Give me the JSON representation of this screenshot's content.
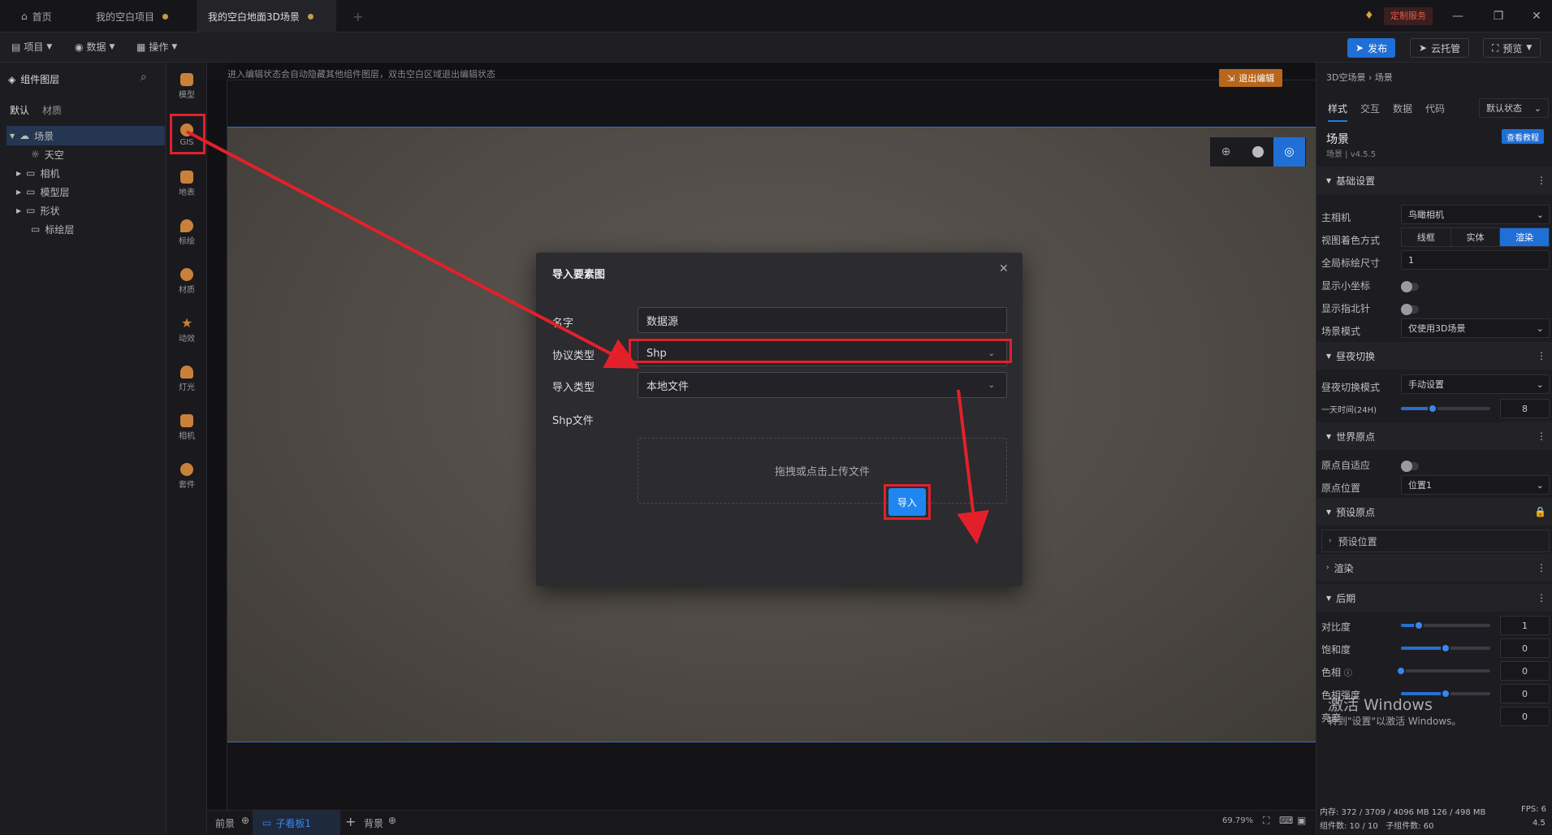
{
  "titlebar": {
    "tabs": [
      {
        "label": "首页"
      },
      {
        "label": "我的空白项目"
      },
      {
        "label": "我的空白地面3D场景"
      }
    ],
    "add_tab": "+",
    "custom_service": "定制服务"
  },
  "toolbar": {
    "menus": [
      "项目",
      "数据",
      "操作"
    ],
    "publish": "发布",
    "cloud_host": "云托管",
    "preview": "预览"
  },
  "layers": {
    "title": "组件图层",
    "tabs": [
      "默认",
      "材质"
    ],
    "items": [
      {
        "label": "场景"
      },
      {
        "label": "天空"
      },
      {
        "label": "相机"
      },
      {
        "label": "模型层"
      },
      {
        "label": "形状"
      },
      {
        "label": "标绘层"
      }
    ]
  },
  "strip": {
    "items": [
      "模型",
      "GIS",
      "地表",
      "标绘",
      "材质",
      "动效",
      "灯光",
      "相机",
      "套件"
    ]
  },
  "canvas": {
    "hint": "进入编辑状态会自动隐藏其他组件图层，双击空白区域退出编辑状态",
    "exit_edit": "退出编辑"
  },
  "modal": {
    "title": "导入要素图",
    "name_label": "名字",
    "name_value": "数据源",
    "protocol_label": "协议类型",
    "protocol_value": "Shp",
    "import_type_label": "导入类型",
    "import_type_value": "本地文件",
    "shp_label": "Shp文件",
    "upload_hint": "拖拽或点击上传文件",
    "import_button": "导入"
  },
  "props": {
    "breadcrumb": "3D空场景 › 场景",
    "tabs": [
      "样式",
      "交互",
      "数据",
      "代码"
    ],
    "state_select": "默认状态",
    "component_name": "场景",
    "component_version": "场景 | v4.5.5",
    "tutorial": "查看教程",
    "sections": {
      "basic": "基础设置",
      "daynight": "昼夜切换",
      "origin": "世界原点",
      "preset": "预设原点",
      "preset_pos": "预设位置",
      "render": "渲染",
      "post": "后期"
    },
    "main_camera_label": "主相机",
    "main_camera_value": "鸟瞰相机",
    "view_color_label": "视图着色方式",
    "view_modes": [
      "线框",
      "实体",
      "渲染"
    ],
    "global_marker_label": "全局标绘尺寸",
    "global_marker_value": "1",
    "show_axis_label": "显示小坐标",
    "show_compass_label": "显示指北针",
    "scene_mode_label": "场景模式",
    "scene_mode_value": "仅使用3D场景",
    "daynight_mode_label": "昼夜切换模式",
    "daynight_mode_value": "手动设置",
    "day_time_label": "一天时间(24H)",
    "day_time_value": "8",
    "day_time_fraction": 0.35,
    "origin_adapt_label": "原点自适应",
    "origin_pos_label": "原点位置",
    "origin_pos_value": "位置1",
    "contrast_label": "对比度",
    "contrast_value": "1",
    "contrast_fraction": 0.2,
    "saturation_label": "饱和度",
    "saturation_value": "0",
    "saturation_fraction": 0.5,
    "hue_label": "色相",
    "hue_value": "0",
    "hue_fraction": 0.0,
    "hue_strength_label": "色相强度",
    "hue_strength_value": "0",
    "brightness_label": "亮度",
    "brightness_value": "0",
    "memory": "内存: 372 / 3709 / 4096 MB 126 / 498 MB",
    "fps": "FPS: 6",
    "counts": "组件数: 10 / 10   子组件数: 60",
    "version": "4.5",
    "watermark_title": "激活 Windows",
    "watermark_sub": "转到\"设置\"以激活 Windows。"
  },
  "bottombar": {
    "foreground": "前景",
    "subboard": "子看板1",
    "background": "背景",
    "zoom": "69.79%"
  },
  "colors": {
    "accent": "#1f7ae0",
    "highlight_red": "#e3202a",
    "exit_edit_bg": "#b7661c"
  }
}
